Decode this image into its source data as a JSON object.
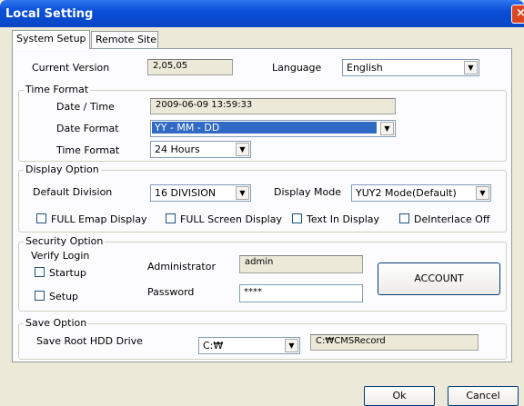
{
  "window": {
    "title": "Local Setting",
    "close_glyph": "×"
  },
  "tabs": [
    "System Setup",
    "Remote Site"
  ],
  "current_version": {
    "label": "Current Version",
    "value": "2,05,05"
  },
  "language": {
    "label": "Language",
    "value": "English"
  },
  "time_format": {
    "group": "Time Format",
    "datetime_label": "Date / Time",
    "datetime_value": "2009-06-09  13:59:33",
    "date_format_label": "Date Format",
    "date_format_value": "YY - MM - DD",
    "time_format_label": "Time Format",
    "time_format_value": "24 Hours"
  },
  "display_option": {
    "group": "Display Option",
    "default_division_label": "Default Division",
    "default_division_value": "16 DIVISION",
    "display_mode_label": "Display Mode",
    "display_mode_value": "YUY2 Mode(Default)",
    "checkboxes": [
      "FULL Emap Display",
      "FULL Screen Display",
      "Text In Display",
      "DeInterlace Off"
    ]
  },
  "security_option": {
    "group": "Security Option",
    "verify_login": "Verify Login",
    "startup": "Startup",
    "setup": "Setup",
    "administrator_label": "Administrator",
    "administrator_value": "admin",
    "password_label": "Password",
    "password_value": "****",
    "account_button": "ACCOUNT"
  },
  "save_option": {
    "group": "Save Option",
    "root_label": "Save Root HDD Drive",
    "drive_value": "C:₩",
    "path_value": "C:₩CMSRecord"
  },
  "buttons": {
    "ok": "Ok",
    "cancel": "Cancel"
  }
}
